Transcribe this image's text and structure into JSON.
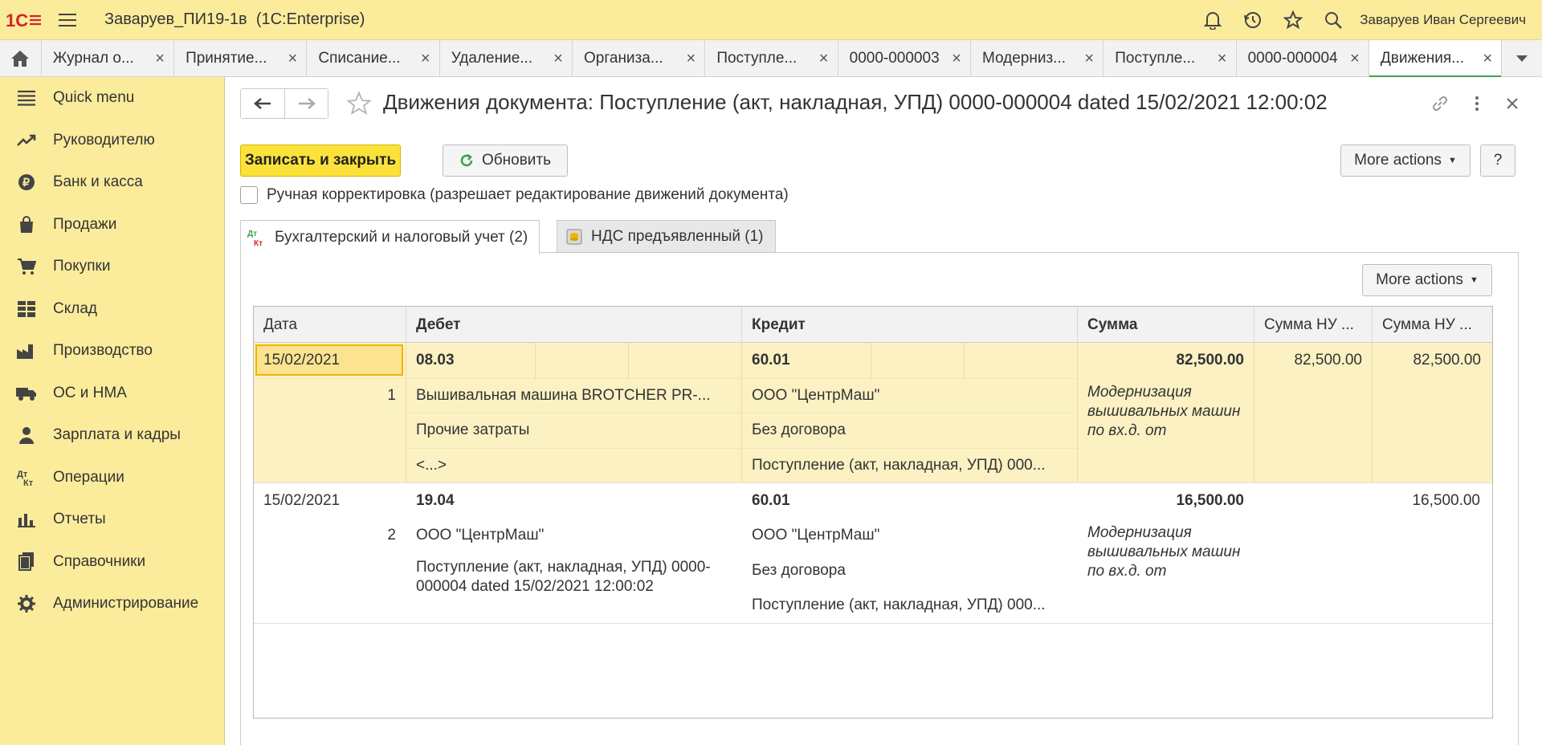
{
  "app": {
    "title": "Заваруев_ПИ19-1в",
    "platform": "(1C:Enterprise)",
    "user": "Заваруев Иван Сергеевич",
    "accent_color": "#fbec9c",
    "logo_color": "#d6232a"
  },
  "tabs": [
    {
      "label": "Журнал о..."
    },
    {
      "label": "Принятие..."
    },
    {
      "label": "Списание..."
    },
    {
      "label": "Удаление..."
    },
    {
      "label": "Организа..."
    },
    {
      "label": "Поступле..."
    },
    {
      "label": "0000-000003"
    },
    {
      "label": "Модерниз..."
    },
    {
      "label": "Поступле..."
    },
    {
      "label": "0000-000004"
    },
    {
      "label": "Движения...",
      "active": true
    }
  ],
  "sidebar": {
    "items": [
      {
        "label": "Quick menu",
        "icon": "list-icon"
      },
      {
        "label": "Руководителю",
        "icon": "trend-icon"
      },
      {
        "label": "Банк и касса",
        "icon": "ruble-icon"
      },
      {
        "label": "Продажи",
        "icon": "bag-icon"
      },
      {
        "label": "Покупки",
        "icon": "cart-icon"
      },
      {
        "label": "Склад",
        "icon": "warehouse-icon"
      },
      {
        "label": "Производство",
        "icon": "factory-icon"
      },
      {
        "label": "ОС и НМА",
        "icon": "truck-icon"
      },
      {
        "label": "Зарплата и кадры",
        "icon": "person-icon"
      },
      {
        "label": "Операции",
        "icon": "dt-kt-icon"
      },
      {
        "label": "Отчеты",
        "icon": "bar-chart-icon"
      },
      {
        "label": "Справочники",
        "icon": "books-icon"
      },
      {
        "label": "Администрирование",
        "icon": "gear-icon"
      }
    ]
  },
  "form": {
    "title": "Движения документа: Поступление (акт, накладная, УПД) 0000-000004 dated 15/02/2021 12:00:02",
    "save_close": "Записать и закрыть",
    "refresh": "Обновить",
    "more_actions": "More actions",
    "help": "?",
    "manual_check_label": "Ручная корректировка (разрешает редактирование движений документа)",
    "manual_check_value": false,
    "page_tabs": [
      {
        "label": "Бухгалтерский и налоговый учет (2)",
        "active": true
      },
      {
        "label": "НДС предъявленный (1)",
        "active": false
      }
    ],
    "table_more_actions": "More actions"
  },
  "table": {
    "headers": {
      "date": "Дата",
      "debit": "Дебет",
      "credit": "Кредит",
      "sum": "Сумма",
      "sum_nu1": "Сумма НУ ...",
      "sum_nu2": "Сумма НУ ..."
    },
    "rows": [
      {
        "date": "15/02/2021",
        "num": "1",
        "debit_account": "08.03",
        "debit_sub1": "Вышивальная машина BROTCHER PR-...",
        "debit_sub2": "Прочие затраты",
        "debit_sub3": "<...>",
        "credit_account": "60.01",
        "credit_sub1": "ООО \"ЦентрМаш\"",
        "credit_sub2": "Без договора",
        "credit_sub3": "Поступление (акт, накладная, УПД) 000...",
        "sum": "82,500.00",
        "content": "Модернизация вышивальных машин по вх.д.  от",
        "sum_nu1": "82,500.00",
        "sum_nu2": "82,500.00"
      },
      {
        "date": "15/02/2021",
        "num": "2",
        "debit_account": "19.04",
        "debit_sub1": "ООО \"ЦентрМаш\"",
        "debit_sub2": "Поступление (акт, накладная, УПД) 0000-000004 dated 15/02/2021 12:00:02",
        "credit_account": "60.01",
        "credit_sub1": "ООО \"ЦентрМаш\"",
        "credit_sub2": "Без договора",
        "credit_sub3": "Поступление (акт, накладная, УПД) 000...",
        "sum": "16,500.00",
        "content": "Модернизация вышивальных машин по вх.д.  от",
        "sum_nu1": "",
        "sum_nu2": "16,500.00"
      }
    ]
  }
}
